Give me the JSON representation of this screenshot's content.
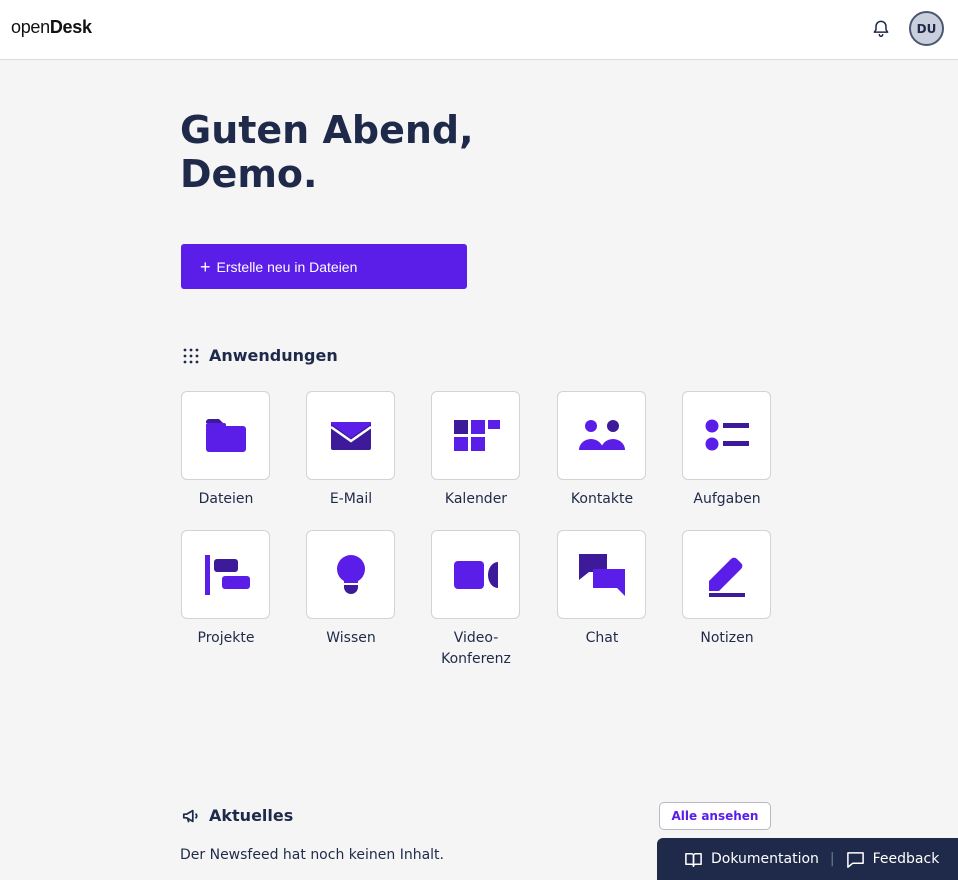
{
  "header": {
    "logo_light": "open",
    "logo_bold": "Desk",
    "bell_icon": "bell-icon",
    "avatar_initials": "DU"
  },
  "greeting": {
    "line1": "Guten Abend,",
    "line2": "Demo."
  },
  "create_button": {
    "icon": "plus-icon",
    "label": "Erstelle neu in Dateien"
  },
  "apps_section": {
    "icon": "grid-dots-icon",
    "title": "Anwendungen",
    "items": [
      {
        "label": "Dateien",
        "icon": "folder-icon"
      },
      {
        "label": "E-Mail",
        "icon": "envelope-icon"
      },
      {
        "label": "Kalender",
        "icon": "calendar-grid-icon"
      },
      {
        "label": "Kontakte",
        "icon": "contacts-icon"
      },
      {
        "label": "Aufgaben",
        "icon": "task-list-icon"
      },
      {
        "label": "Projekte",
        "icon": "project-timeline-icon"
      },
      {
        "label": "Wissen",
        "icon": "lightbulb-icon"
      },
      {
        "label": "Video-\nKonferenz",
        "icon": "video-camera-icon"
      },
      {
        "label": "Chat",
        "icon": "chat-bubbles-icon"
      },
      {
        "label": "Notizen",
        "icon": "pen-note-icon"
      }
    ]
  },
  "news_section": {
    "icon": "megaphone-icon",
    "title": "Aktuelles",
    "view_all_label": "Alle ansehen",
    "empty_text": "Der Newsfeed hat noch keinen Inhalt."
  },
  "footer": {
    "docs_label": "Dokumentation",
    "docs_icon": "book-icon",
    "separator": "|",
    "feedback_label": "Feedback",
    "feedback_icon": "feedback-bubble-icon"
  },
  "colors": {
    "accent": "#5a1ee8",
    "accent_dark": "#3d1a9a",
    "text_dark": "#1f2a4a",
    "background": "#f5f5f5"
  }
}
